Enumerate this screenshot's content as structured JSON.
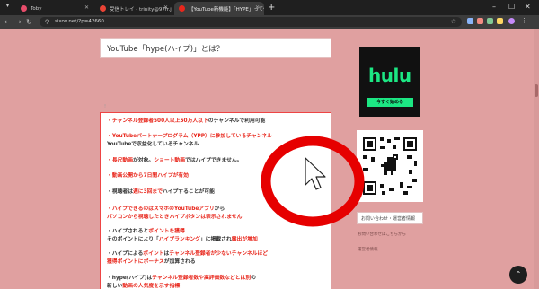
{
  "browser": {
    "tabs": [
      {
        "title": "Toby",
        "favicon_color": "#e74c6a"
      },
      {
        "title": "受信トレイ - trinity@97fr.jp - 97fr",
        "favicon_color": "#ea4335"
      },
      {
        "title": "【YouTube新機能】「HYPE」って何",
        "favicon_color": "#e8271c"
      }
    ],
    "new_tab_label": "+",
    "address": "sixov.net/?p=42660",
    "window_controls": [
      "–",
      "☐",
      "✕"
    ]
  },
  "page": {
    "heading": "YouTube「hype(ハイプ)」とは？",
    "stray_mark": "!",
    "items": [
      {
        "segments": [
          {
            "t": "・",
            "c": "red"
          },
          {
            "t": "チャンネル登録者500人以上50万人以下",
            "c": "red"
          },
          {
            "t": "のチャンネルで利用可能",
            "c": "blk"
          }
        ]
      },
      {
        "segments": [
          {
            "t": "・",
            "c": "red"
          },
          {
            "t": "YouTubeパートナープログラム（YPP）に参加しているチャンネル",
            "c": "red"
          }
        ],
        "line2": [
          {
            "t": "YouTubeで収益化しているチャンネル",
            "c": "blk"
          }
        ]
      },
      {
        "segments": [
          {
            "t": "・",
            "c": "red"
          },
          {
            "t": "長尺動画",
            "c": "red"
          },
          {
            "t": "が対象。",
            "c": "blk"
          },
          {
            "t": "ショート動画",
            "c": "red"
          },
          {
            "t": "ではハイプできません。",
            "c": "blk"
          }
        ]
      },
      {
        "segments": [
          {
            "t": "・",
            "c": "red"
          },
          {
            "t": "動画公開から7日間ハイプが有効",
            "c": "red"
          }
        ]
      },
      {
        "segments": [
          {
            "t": "・視聴者は",
            "c": "blk"
          },
          {
            "t": "週に3回まで",
            "c": "red"
          },
          {
            "t": "ハイプすることが可能",
            "c": "blk"
          }
        ]
      },
      {
        "segments": [
          {
            "t": "・",
            "c": "red"
          },
          {
            "t": "ハイプできるのはスマホのYouTubeアプリ",
            "c": "red"
          },
          {
            "t": "から",
            "c": "blk"
          }
        ],
        "line2": [
          {
            "t": "パソコンから視聴したときハイプボタンは表示されません",
            "c": "red"
          }
        ]
      },
      {
        "segments": [
          {
            "t": "・ハイプされると",
            "c": "blk"
          },
          {
            "t": "ポイントを獲得",
            "c": "red"
          }
        ],
        "line2": [
          {
            "t": "そのポイントにより「",
            "c": "blk"
          },
          {
            "t": "ハイプランキング",
            "c": "red"
          },
          {
            "t": "」に掲載され",
            "c": "blk"
          },
          {
            "t": "露出が増加",
            "c": "red"
          }
        ]
      },
      {
        "segments": [
          {
            "t": "・ハイプによる",
            "c": "blk"
          },
          {
            "t": "ポイント",
            "c": "red"
          },
          {
            "t": "は",
            "c": "blk"
          },
          {
            "t": "チャンネル登録者が少ないチャンネルほど",
            "c": "red"
          }
        ],
        "line2": [
          {
            "t": "獲得ポイントにボーナス",
            "c": "red"
          },
          {
            "t": "が加算される",
            "c": "blk"
          }
        ]
      },
      {
        "segments": [
          {
            "t": "・hype(ハイプ)は",
            "c": "blk"
          },
          {
            "t": "チャンネル登録者数や高評価数などとは別",
            "c": "red"
          },
          {
            "t": "の",
            "c": "blk"
          }
        ],
        "line2": [
          {
            "t": "新しい",
            "c": "blk"
          },
          {
            "t": "動画の人気度を示す指標",
            "c": "red"
          }
        ]
      }
    ]
  },
  "sidebar": {
    "ad": {
      "logo": "hulu",
      "cta": "今すぐ始める",
      "brand_color": "#1ce783"
    },
    "contact_title": "お問い合わせ・運営者情報",
    "links": [
      "お問い合わせはこちらから",
      "運営者情報"
    ]
  },
  "annotation": {
    "circle_color": "#e60000"
  },
  "scroll_top_label": "⌃"
}
